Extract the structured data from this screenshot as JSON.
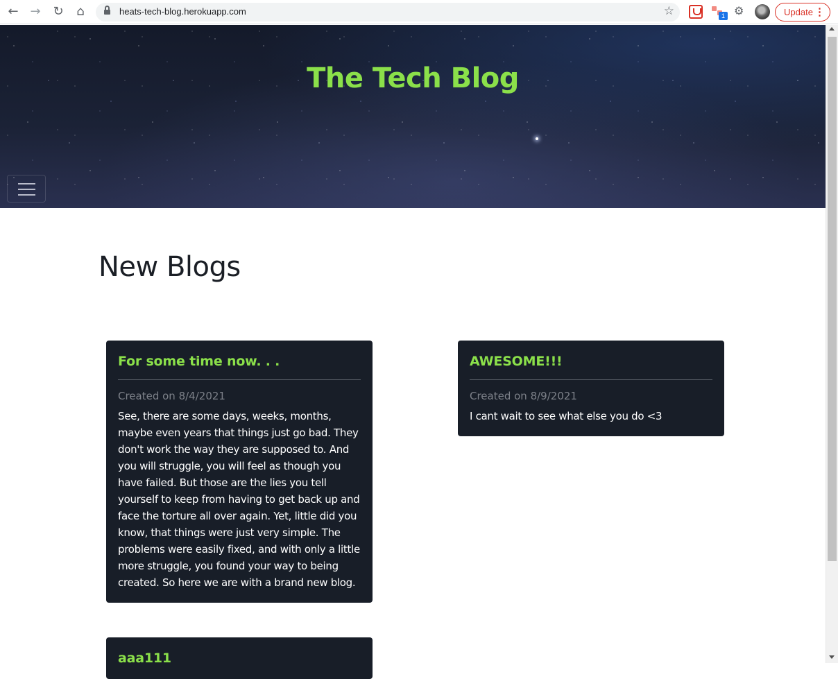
{
  "browser": {
    "url": "heats-tech-blog.herokuapp.com",
    "update_label": "Update",
    "extension_badge": "1"
  },
  "header": {
    "title": "The Tech Blog"
  },
  "main": {
    "section_title": "New Blogs",
    "posts": [
      {
        "title": "For some time now. . .",
        "date": "Created on 8/4/2021",
        "body": "See, there are some days, weeks, months, maybe even years that things just go bad. They don't work the way they are supposed to. And you will struggle, you will feel as though you have failed. But those are the lies you tell yourself to keep from having to get back up and face the torture all over again. Yet, little did you know, that things were just very simple. The problems were easily fixed, and with only a little more struggle, you found your way to being created. So here we are with a brand new blog."
      },
      {
        "title": "AWESOME!!!",
        "date": "Created on 8/9/2021",
        "body": "I cant wait to see what else you do <3"
      },
      {
        "title": "aaa111"
      }
    ]
  },
  "colors": {
    "accent_green": "#8be04a",
    "card_bg": "#181e28",
    "update_red": "#d93025"
  },
  "icons": {
    "back": "arrow-left-icon",
    "forward": "arrow-right-icon",
    "reload": "reload-icon",
    "home": "home-icon",
    "lock": "lock-icon",
    "bookmark": "star-icon",
    "menu": "hamburger-menu-icon"
  }
}
